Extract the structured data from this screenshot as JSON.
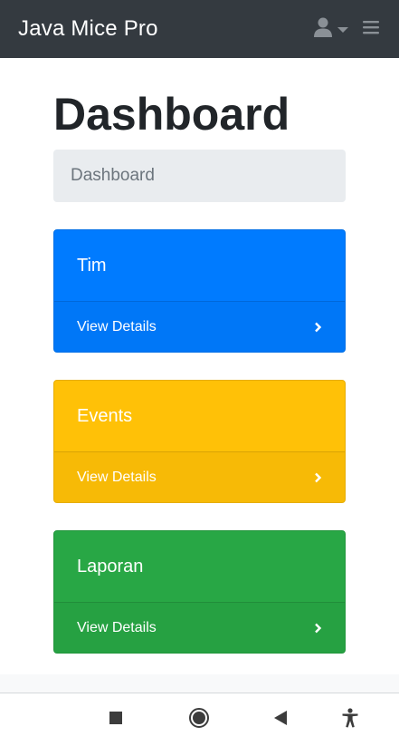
{
  "navbar": {
    "brand": "Java Mice Pro",
    "user_icon": "user-icon",
    "dropdown_icon": "caret-down-icon",
    "menu_icon": "hamburger-menu-icon"
  },
  "page": {
    "title": "Dashboard",
    "breadcrumb": "Dashboard"
  },
  "cards": [
    {
      "title": "Tim",
      "footer": "View Details",
      "color": "#007bff",
      "icon": "chevron-right-icon"
    },
    {
      "title": "Events",
      "footer": "View Details",
      "color": "#ffc107",
      "icon": "chevron-right-icon"
    },
    {
      "title": "Laporan",
      "footer": "View Details",
      "color": "#28a745",
      "icon": "chevron-right-icon"
    }
  ],
  "android_nav": {
    "recents_icon": "square-recents-icon",
    "home_icon": "circle-home-icon",
    "back_icon": "triangle-back-icon",
    "accessibility_icon": "accessibility-icon"
  }
}
